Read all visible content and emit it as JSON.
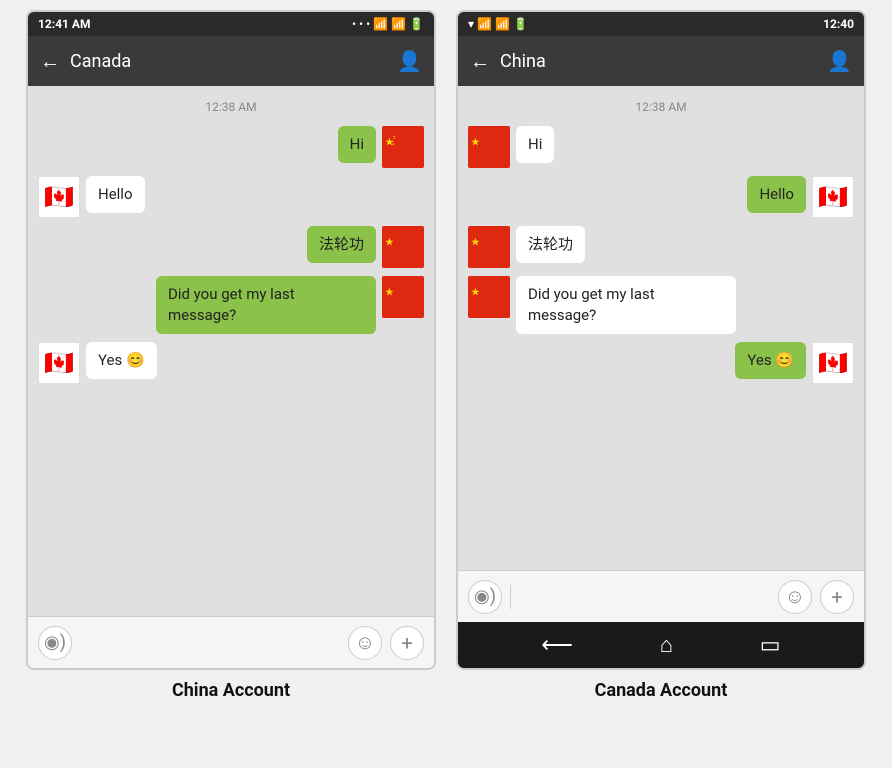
{
  "left_phone": {
    "status_bar": {
      "time": "12:41 AM",
      "icons": "... ▾ ▾ ■"
    },
    "header": {
      "title": "Canada",
      "back_label": "←",
      "person_icon": "👤"
    },
    "chat": {
      "timestamp": "12:38 AM",
      "messages": [
        {
          "id": 1,
          "type": "outgoing",
          "text": "Hi",
          "flag": "china"
        },
        {
          "id": 2,
          "type": "incoming",
          "text": "Hello",
          "flag": "canada"
        },
        {
          "id": 3,
          "type": "outgoing",
          "text": "法轮功",
          "flag": "china"
        },
        {
          "id": 4,
          "type": "outgoing",
          "text": "Did you get my last message?",
          "flag": "china"
        },
        {
          "id": 5,
          "type": "incoming",
          "text": "Yes 😊",
          "flag": "canada"
        }
      ]
    },
    "input_bar": {
      "voice_icon": "◉)",
      "emoji_icon": "☺",
      "plus_icon": "+"
    },
    "caption": "China Account"
  },
  "right_phone": {
    "status_bar": {
      "time": "12:40",
      "icons": "▾ ▾ 🔋"
    },
    "header": {
      "title": "China",
      "back_label": "←",
      "person_icon": "👤"
    },
    "chat": {
      "timestamp": "12:38 AM",
      "messages": [
        {
          "id": 1,
          "type": "incoming",
          "text": "Hi",
          "flag": "china"
        },
        {
          "id": 2,
          "type": "outgoing",
          "text": "Hello",
          "flag": "canada"
        },
        {
          "id": 3,
          "type": "incoming",
          "text": "法轮功",
          "flag": "china"
        },
        {
          "id": 4,
          "type": "incoming",
          "text": "Did you get my last message?",
          "flag": "china"
        },
        {
          "id": 5,
          "type": "outgoing",
          "text": "Yes 😊",
          "flag": "canada"
        }
      ]
    },
    "input_bar": {
      "voice_icon": "◉)",
      "emoji_icon": "☺",
      "plus_icon": "+"
    },
    "nav_bar": {
      "back": "⟵",
      "home": "⌂",
      "recent": "▭"
    },
    "caption": "Canada Account"
  }
}
